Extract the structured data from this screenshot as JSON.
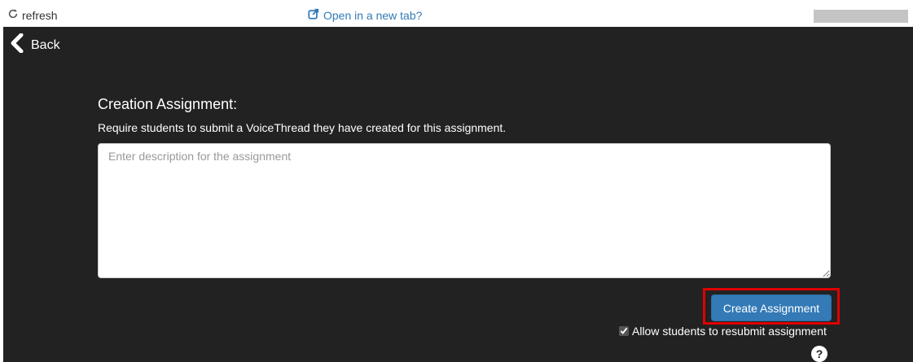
{
  "topbar": {
    "refresh_label": "refresh",
    "open_tab_label": "Open in a new tab?"
  },
  "nav": {
    "back_label": "Back"
  },
  "assignment": {
    "heading": "Creation Assignment:",
    "description": "Require students to submit a VoiceThread they have created for this assignment.",
    "textarea_value": "",
    "textarea_placeholder": "Enter description for the assignment",
    "create_button_label": "Create Assignment",
    "resubmit_label": "Allow students to resubmit assignment",
    "resubmit_checked": true,
    "help_glyph": "?"
  },
  "icons": {
    "refresh": "refresh-icon",
    "open_tab": "external-link-icon",
    "back": "chevron-left-icon",
    "help": "question-circle-icon"
  },
  "colors": {
    "background": "#222222",
    "link": "#337ab7",
    "primary_button": "#337ab7",
    "highlight": "#e00000"
  }
}
